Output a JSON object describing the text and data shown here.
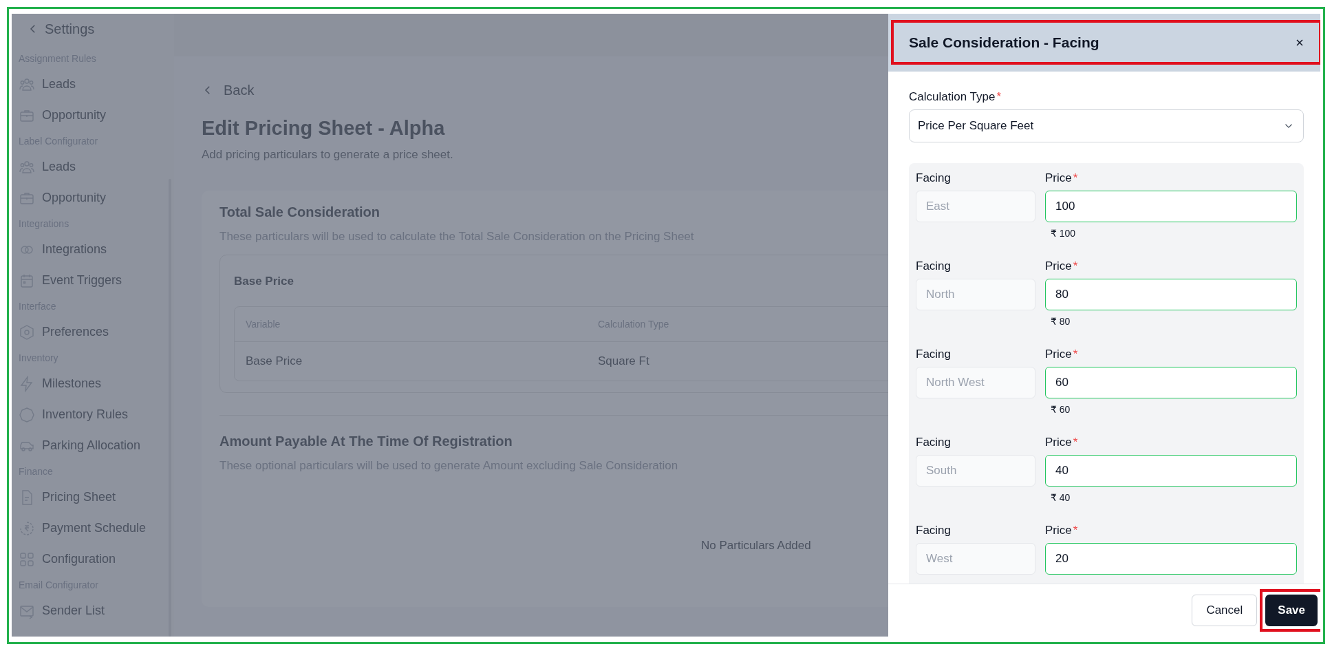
{
  "sidebar": {
    "back_label": "Settings",
    "sections": [
      {
        "title": "Assignment Rules",
        "items": [
          {
            "label": "Leads"
          },
          {
            "label": "Opportunity"
          }
        ]
      },
      {
        "title": "Label Configurator",
        "items": [
          {
            "label": "Leads"
          },
          {
            "label": "Opportunity"
          }
        ]
      },
      {
        "title": "Integrations",
        "items": [
          {
            "label": "Integrations"
          },
          {
            "label": "Event Triggers"
          }
        ]
      },
      {
        "title": "Interface",
        "items": [
          {
            "label": "Preferences"
          }
        ]
      },
      {
        "title": "Inventory",
        "items": [
          {
            "label": "Milestones"
          },
          {
            "label": "Inventory Rules"
          },
          {
            "label": "Parking Allocation"
          }
        ]
      },
      {
        "title": "Finance",
        "items": [
          {
            "label": "Pricing Sheet"
          },
          {
            "label": "Payment Schedule"
          },
          {
            "label": "Configuration"
          }
        ]
      },
      {
        "title": "Email Configurator",
        "items": [
          {
            "label": "Sender List"
          }
        ]
      }
    ]
  },
  "page": {
    "back_label": "Back",
    "title": "Edit Pricing Sheet - Alpha",
    "subtitle": "Add pricing particulars to generate a price sheet.",
    "total_sale": {
      "title": "Total Sale Consideration",
      "description": "These particulars will be used to calculate the Total Sale Consideration on the Pricing Sheet",
      "particular": {
        "name": "Base Price",
        "table": {
          "columns": [
            "Variable",
            "Calculation Type"
          ],
          "rows": [
            [
              "Base Price",
              "Square Ft"
            ]
          ]
        }
      }
    },
    "registration": {
      "title": "Amount Payable At The Time Of Registration",
      "description": "These optional particulars will be used to generate Amount excluding Sale Consideration",
      "empty_text": "No Particulars Added"
    }
  },
  "drawer": {
    "title": "Sale Consideration - Facing",
    "calculation_type": {
      "label": "Calculation Type",
      "required_mark": "*",
      "value": "Price Per Square Feet"
    },
    "rows": [
      {
        "facing_label": "Facing",
        "facing": "East",
        "price_label": "Price",
        "required_mark": "*",
        "price": "100",
        "hint": "₹ 100"
      },
      {
        "facing_label": "Facing",
        "facing": "North",
        "price_label": "Price",
        "required_mark": "*",
        "price": "80",
        "hint": "₹ 80"
      },
      {
        "facing_label": "Facing",
        "facing": "North West",
        "price_label": "Price",
        "required_mark": "*",
        "price": "60",
        "hint": "₹ 60"
      },
      {
        "facing_label": "Facing",
        "facing": "South",
        "price_label": "Price",
        "required_mark": "*",
        "price": "40",
        "hint": "₹ 40"
      },
      {
        "facing_label": "Facing",
        "facing": "West",
        "price_label": "Price",
        "required_mark": "*",
        "price": "20"
      }
    ],
    "buttons": {
      "cancel": "Cancel",
      "save": "Save"
    }
  }
}
